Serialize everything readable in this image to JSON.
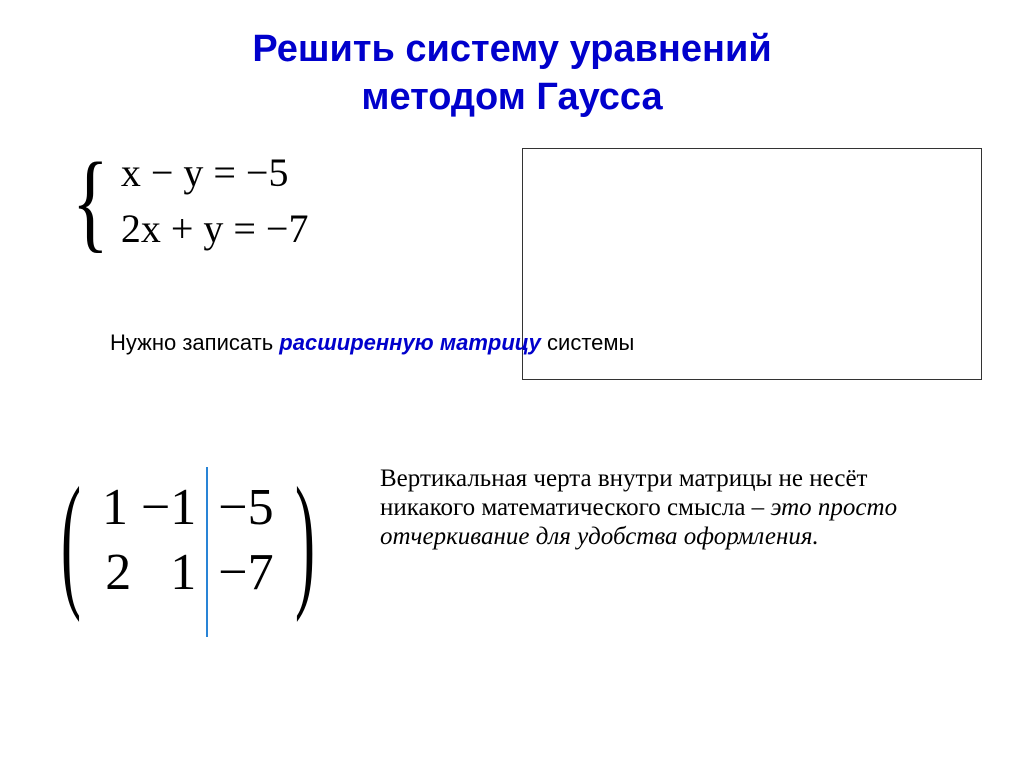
{
  "title_line1": "Решить систему уравнений",
  "title_line2": "методом Гаусса",
  "equations": {
    "line1": "x − y = −5",
    "line2": "2x + y = −7"
  },
  "explain1_pre": "Нужно записать ",
  "explain1_em": "расширенную матрицу",
  "explain1_post": " системы",
  "matrix": {
    "r1c1": "1",
    "r1c2": "−1",
    "r1c3": "−5",
    "r2c1": "2",
    "r2c2": "1",
    "r2c3": "−7"
  },
  "explain2_normal": "Вертикальная черта внутри матрицы не несёт никакого математического смысла – ",
  "explain2_ital": "это просто отчеркивание для удобства оформления.",
  "frame_caption": ""
}
